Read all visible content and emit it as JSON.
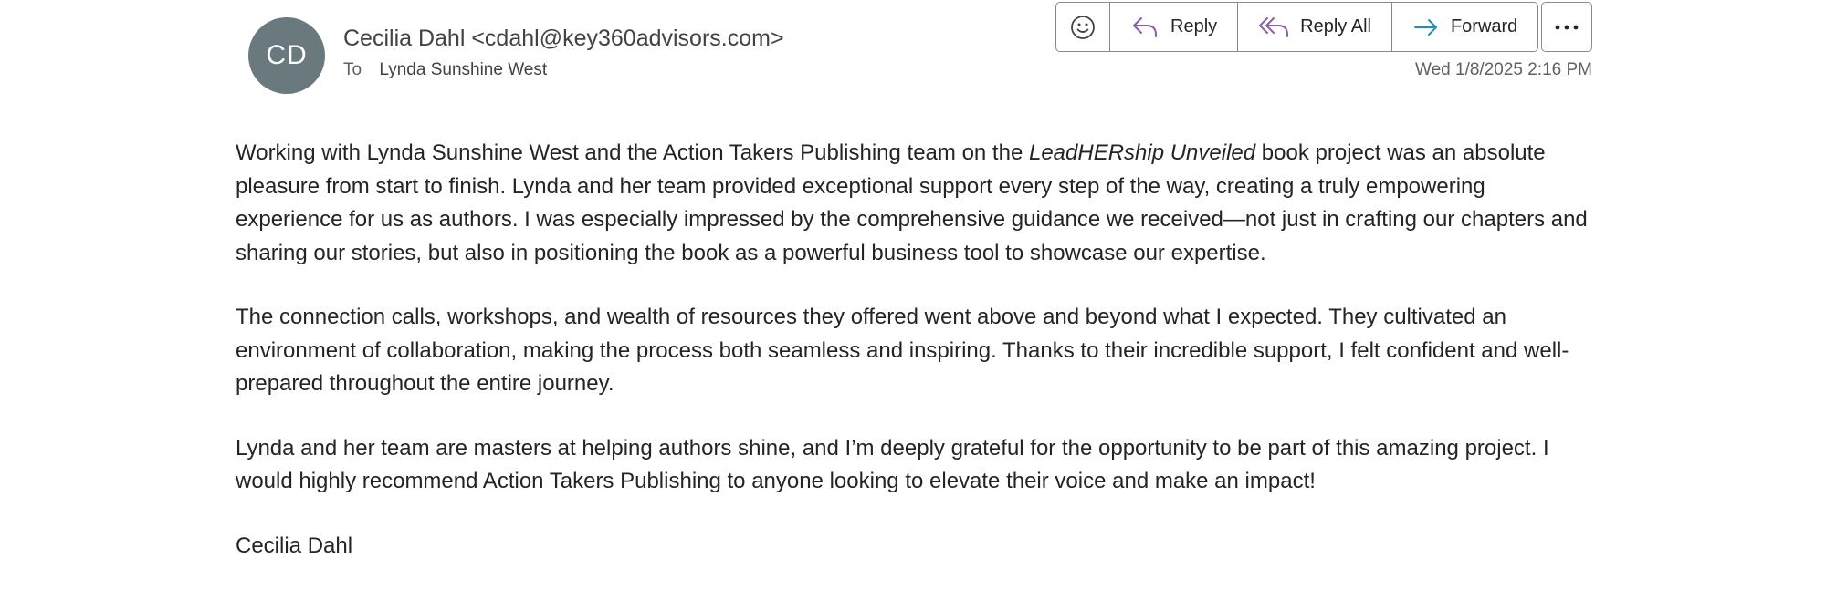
{
  "message": {
    "avatar_initials": "CD",
    "sender": "Cecilia Dahl <cdahl@key360advisors.com>",
    "to_label": "To",
    "recipient": "Lynda Sunshine West",
    "timestamp": "Wed 1/8/2025 2:16 PM"
  },
  "toolbar": {
    "emoji_icon": "smiley-icon",
    "reply_label": "Reply",
    "reply_all_label": "Reply All",
    "forward_label": "Forward",
    "more_icon": "more-horizontal-icon"
  },
  "body": {
    "p1_before": "Working with Lynda Sunshine West and the Action Takers Publishing team on the ",
    "p1_title": "LeadHERship Unveiled",
    "p1_after": " book project was an absolute pleasure from start to finish. Lynda and her team provided exceptional support every step of the way, creating a truly empowering experience for us as authors. I was especially impressed by the comprehensive guidance we received—not just in crafting our chapters and sharing our stories, but also in positioning the book as a powerful business tool to showcase our expertise.",
    "p2": "The connection calls, workshops, and wealth of resources they offered went above and beyond what I expected. They cultivated an environment of collaboration, making the process both seamless and inspiring. Thanks to their incredible support, I felt confident and well-prepared throughout the entire journey.",
    "p3": "Lynda and her team are masters at helping authors shine, and I’m deeply grateful for the opportunity to be part of this amazing project. I would highly recommend Action Takers Publishing to anyone looking to elevate their voice and make an impact!",
    "signature": "Cecilia Dahl"
  },
  "colors": {
    "avatar_bg": "#69797e",
    "accent_icon": "#8b5ea8",
    "forward_icon": "#1f8fbf"
  }
}
